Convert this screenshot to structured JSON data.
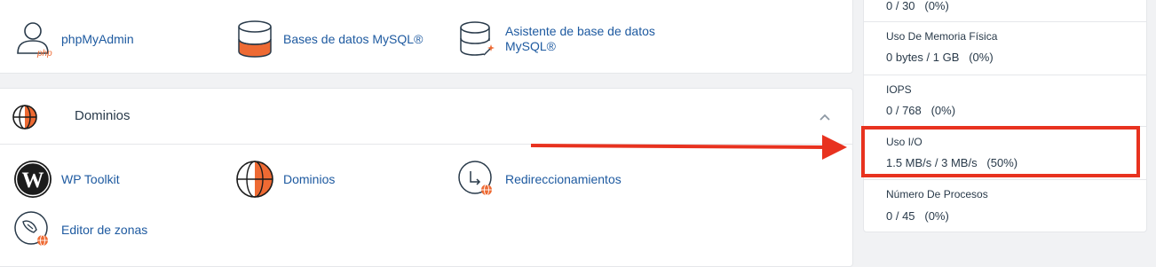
{
  "database_section": {
    "apps": [
      {
        "label": "phpMyAdmin",
        "icon": "phpmyadmin-icon"
      },
      {
        "label": "Bases de datos MySQL®",
        "icon": "mysql-database-icon"
      },
      {
        "label": "Asistente de base de datos MySQL®",
        "icon": "mysql-wizard-icon"
      }
    ]
  },
  "domains_section": {
    "title": "Dominios",
    "icon": "globe-icon",
    "apps": [
      {
        "label": "WP Toolkit",
        "icon": "wordpress-icon"
      },
      {
        "label": "Dominios",
        "icon": "domains-globe-icon"
      },
      {
        "label": "Redireccionamientos",
        "icon": "redirect-icon"
      },
      {
        "label": "Editor de zonas",
        "icon": "zone-editor-icon"
      }
    ]
  },
  "stats": [
    {
      "name": "",
      "value": "0 / 30   (0%)"
    },
    {
      "name": "Uso De Memoria Física",
      "value": "0 bytes / 1 GB   (0%)"
    },
    {
      "name": "IOPS",
      "value": "0 / 768   (0%)"
    },
    {
      "name": "Uso I/O",
      "value": "1.5 MB/s / 3 MB/s   (50%)"
    },
    {
      "name": "Número De Procesos",
      "value": "0 / 45   (0%)"
    }
  ],
  "colors": {
    "accent_orange": "#ee6a33",
    "link_blue": "#1e5aa0",
    "highlight_red": "#e8321f"
  }
}
